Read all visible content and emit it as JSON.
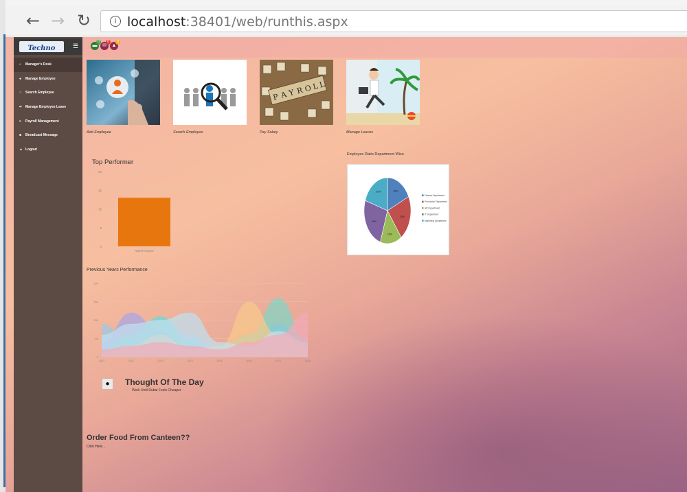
{
  "browser": {
    "back_icon": "arrow-left-icon",
    "forward_icon": "arrow-right-icon",
    "reload_icon": "reload-icon",
    "url_host": "localhost",
    "url_rest": ":38401/web/runthis.aspx"
  },
  "logo": {
    "text": "Techno"
  },
  "sidebar": {
    "items": [
      {
        "label": "Manager's Desk",
        "icon": "home-icon"
      },
      {
        "label": "Manage Employee",
        "icon": "user-icon"
      },
      {
        "label": "Search Employee",
        "icon": "search-icon"
      },
      {
        "label": "Manage Employee Leave",
        "icon": "leave-icon"
      },
      {
        "label": "Payroll Management",
        "icon": "list-icon"
      },
      {
        "label": "Broadcast Message",
        "icon": "broadcast-icon"
      },
      {
        "label": "Logout",
        "icon": "logout-icon"
      }
    ]
  },
  "topbar": {
    "notifications": [
      {
        "icon": "chat-icon",
        "badge": "0",
        "color": "#2e7d32",
        "badge_color": "#43a047"
      },
      {
        "icon": "mail-icon",
        "badge": "0",
        "color": "#8e2a4a",
        "badge_color": "#e53935"
      },
      {
        "icon": "bell-icon",
        "badge": "0",
        "color": "#8e2a4a",
        "badge_color": "#f9a825"
      }
    ]
  },
  "tiles": [
    {
      "caption": "Add Employee"
    },
    {
      "caption": "Search Employee"
    },
    {
      "caption": "Pay Salary"
    },
    {
      "caption": "Manage Leaves"
    }
  ],
  "top_performer_title": "Top Performer",
  "pie_title": "Employee Ratio Department Wise",
  "prev_years_title": "Previous Years Performance",
  "thought": {
    "title": "Thought Of The Day",
    "quote": "Work Until Dubai Feels Cheaper"
  },
  "canteen": {
    "title": "Order Food From Canteen??",
    "link": "Click Here..."
  },
  "colors": {
    "sidebar": "#5c4a44",
    "bar": "#e8760f"
  },
  "chart_data": [
    {
      "type": "bar",
      "title": "Top Performer",
      "categories": [
        "Rajesh Kapoor"
      ],
      "values": [
        13
      ],
      "ylim": [
        0,
        20
      ],
      "yticks": [
        0,
        5,
        10,
        15,
        20
      ],
      "grid": true
    },
    {
      "type": "pie",
      "title": "Employee Ratio Department Wise",
      "labels": [
        "Finance Department",
        "Production Department",
        "HR Department",
        "IT Department",
        "Marketing Department"
      ],
      "values": [
        18,
        22,
        15,
        25,
        20
      ],
      "colors": [
        "#4f81bd",
        "#c0504d",
        "#9bbb59",
        "#8064a2",
        "#4bacc6"
      ],
      "slice_labels": [
        "18%",
        "22%",
        "15%",
        "25%",
        "20%"
      ],
      "legend": "right"
    },
    {
      "type": "area",
      "title": "Previous Years Performance",
      "x": [
        2011,
        2012,
        2013,
        2014,
        2015,
        2016,
        2017,
        2018
      ],
      "ylim": [
        0,
        200
      ],
      "yticks": [
        0,
        50,
        100,
        150,
        200
      ],
      "series": [
        {
          "color": "#9ec9e6",
          "values": [
            90,
            40,
            110,
            60,
            20,
            60,
            90,
            50
          ]
        },
        {
          "color": "#a8a6e8",
          "values": [
            40,
            120,
            70,
            20,
            10,
            40,
            90,
            30
          ]
        },
        {
          "color": "#7fd6c6",
          "values": [
            20,
            60,
            110,
            40,
            10,
            60,
            160,
            40
          ]
        },
        {
          "color": "#f7c98a",
          "values": [
            10,
            30,
            60,
            20,
            30,
            150,
            60,
            30
          ]
        },
        {
          "color": "#bfe0f0",
          "values": [
            60,
            90,
            100,
            120,
            40,
            30,
            70,
            40
          ]
        },
        {
          "color": "#f3aab8",
          "values": [
            20,
            30,
            40,
            30,
            20,
            40,
            60,
            120
          ]
        }
      ]
    }
  ]
}
